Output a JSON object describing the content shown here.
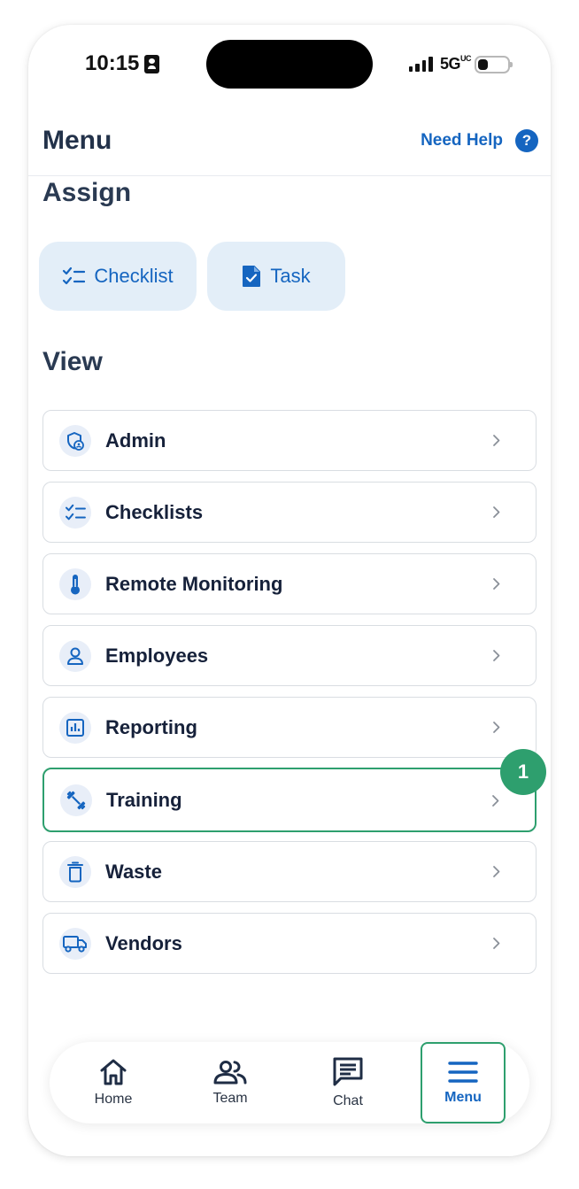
{
  "status_bar": {
    "time": "10:15",
    "network": "5G",
    "network_suffix": "UC"
  },
  "header": {
    "title": "Menu",
    "help_label": "Need Help",
    "help_icon_glyph": "?"
  },
  "assign": {
    "title": "Assign",
    "buttons": [
      {
        "label": "Checklist",
        "icon": "checklist-icon"
      },
      {
        "label": "Task",
        "icon": "task-document-icon"
      }
    ]
  },
  "view": {
    "title": "View",
    "items": [
      {
        "label": "Admin",
        "icon": "admin-shield-icon"
      },
      {
        "label": "Checklists",
        "icon": "checklist-icon"
      },
      {
        "label": "Remote Monitoring",
        "icon": "thermometer-icon"
      },
      {
        "label": "Employees",
        "icon": "person-icon"
      },
      {
        "label": "Reporting",
        "icon": "bar-chart-icon"
      },
      {
        "label": "Training",
        "icon": "dumbbell-icon"
      },
      {
        "label": "Waste",
        "icon": "trash-icon"
      },
      {
        "label": "Vendors",
        "icon": "truck-icon"
      }
    ]
  },
  "badge": {
    "value": "1"
  },
  "bottom_nav": {
    "items": [
      {
        "label": "Home",
        "icon": "home-icon"
      },
      {
        "label": "Team",
        "icon": "team-icon"
      },
      {
        "label": "Chat",
        "icon": "chat-icon"
      },
      {
        "label": "Menu",
        "icon": "menu-icon"
      }
    ],
    "active": "Menu"
  },
  "colors": {
    "accent": "#1565c0",
    "highlight": "#2e9f6e",
    "title": "#23324a",
    "chip_bg": "#e3eef8"
  }
}
